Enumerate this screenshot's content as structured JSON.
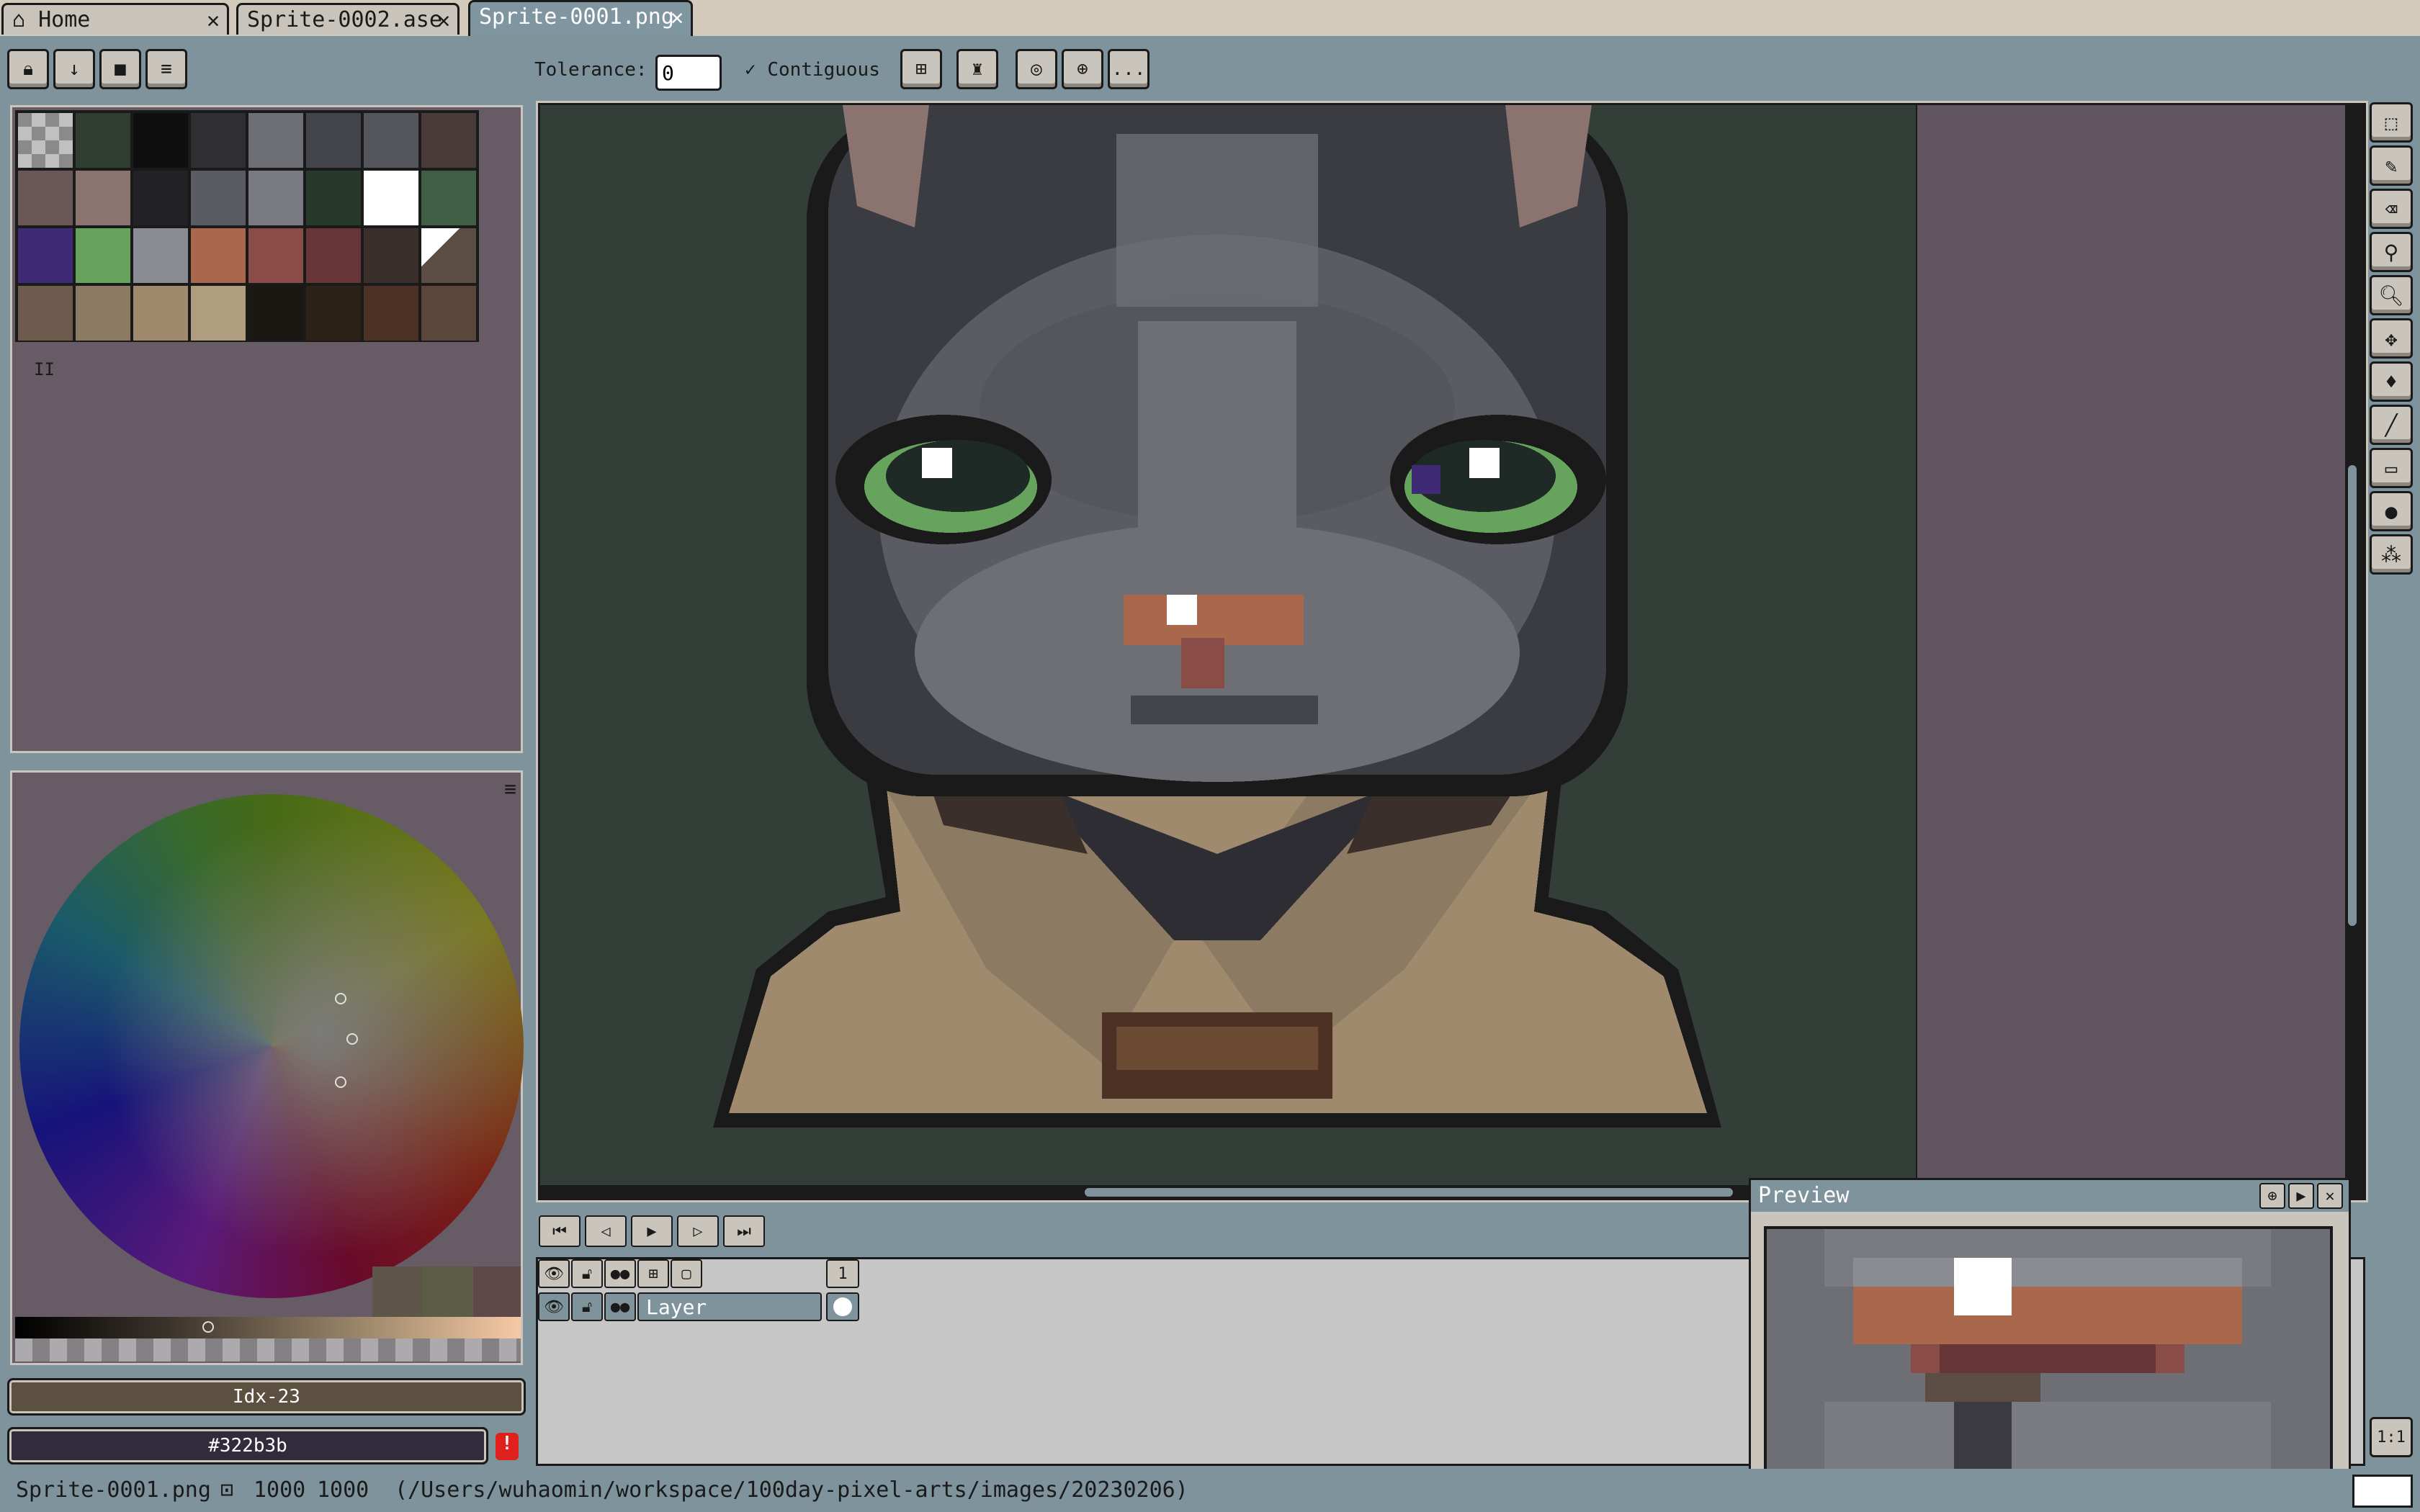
{
  "tabs": [
    {
      "label": "Home",
      "icon": "home-icon"
    },
    {
      "label": "Sprite-0002.ase"
    },
    {
      "label": "Sprite-0001.png",
      "active": true
    }
  ],
  "tab_close": "✕",
  "layer_toolbar": {
    "buttons": [
      "lock-icon",
      "merge-down-icon",
      "stop-icon",
      "menu-icon"
    ]
  },
  "context_bar": {
    "tolerance_label": "Tolerance:",
    "tolerance_value": "0",
    "contiguous_label": "Contiguous",
    "contiguous_checked": true,
    "more": "..."
  },
  "palette": {
    "swatches": [
      "#a9a9a9",
      "#2f3d33",
      "#0f0f0f",
      "#2e2e33",
      "#6e6e75",
      "#44444c",
      "#55555c",
      "#4b3a3a",
      "#6b5755",
      "#8b7470",
      "#222226",
      "#5b5b63",
      "#7a7a83",
      "#26392b",
      "#ffffff",
      "#3f5e44",
      "#3e2a75",
      "#66a35d",
      "#8b8b93",
      "#a9674c",
      "#8a4c47",
      "#673537",
      "#3a2f2b",
      "#5b4c44",
      "#6f5b4e",
      "#8d7a63",
      "#a08a6d",
      "#b09c7e",
      "#1b1712",
      "#2d2218",
      "#4c3124",
      "#5b463b"
    ],
    "selected_index": 23,
    "pause_glyph": "II"
  },
  "color_wheel": {
    "menu_glyph": "≡",
    "current_swatches": [
      "#5c5548",
      "#5c5d45",
      "#5e4848"
    ]
  },
  "color_index_label": "Idx-23",
  "hex_label": "#322b3b",
  "warning_glyph": "!",
  "tools": [
    "marquee-icon",
    "pencil-icon",
    "eraser-icon",
    "eyedropper-icon",
    "zoom-icon",
    "move-icon",
    "paint-bucket-icon",
    "line-icon",
    "rectangle-icon",
    "blur-icon",
    "spray-icon"
  ],
  "accent": "#c9c4bc",
  "playback": [
    "first-frame-icon",
    "previous-frame-icon",
    "play-icon",
    "next-frame-icon",
    "last-frame-icon"
  ],
  "timeline": {
    "frame_number": "1",
    "layer_name": "Layer"
  },
  "preview": {
    "title": "Preview",
    "buttons": [
      "center-icon",
      "play-icon",
      "close-icon"
    ]
  },
  "zoom_button": "1:1",
  "status": {
    "filename": "Sprite-0001.png",
    "width": "1000",
    "height": "1000",
    "path": "(/Users/wuhaomin/workspace/100day-pixel-arts/images/20230206)"
  }
}
